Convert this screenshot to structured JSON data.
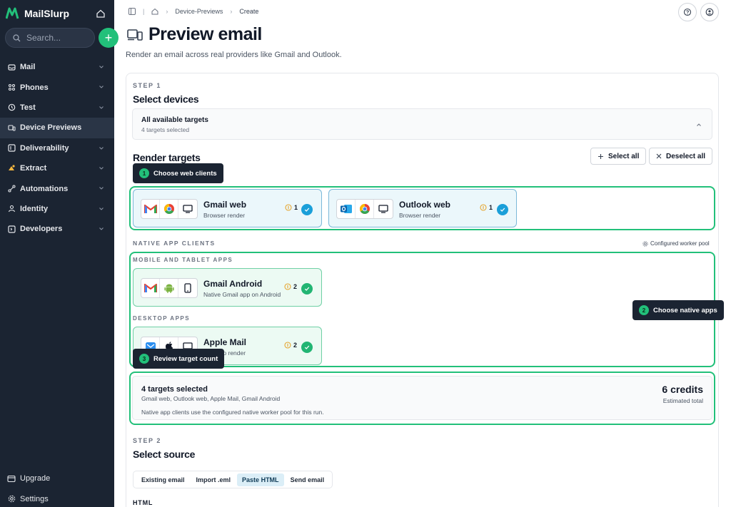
{
  "app": {
    "name": "MailSlurp"
  },
  "sidebar": {
    "search_placeholder": "Search...",
    "add_symbol": "+",
    "items": [
      {
        "label": "Mail",
        "icon": "mail-icon"
      },
      {
        "label": "Phones",
        "icon": "phones-icon"
      },
      {
        "label": "Test",
        "icon": "test-icon"
      },
      {
        "label": "Device Previews",
        "icon": "device-previews-icon"
      },
      {
        "label": "Deliverability",
        "icon": "deliverability-icon"
      },
      {
        "label": "Extract",
        "icon": "extract-icon"
      },
      {
        "label": "Automations",
        "icon": "automations-icon"
      },
      {
        "label": "Identity",
        "icon": "identity-icon"
      },
      {
        "label": "Developers",
        "icon": "developers-icon"
      }
    ],
    "active_item": "Device Previews",
    "bottom": [
      {
        "label": "Upgrade",
        "icon": "upgrade-icon"
      },
      {
        "label": "Settings",
        "icon": "gear-icon"
      }
    ]
  },
  "breadcrumb": {
    "section": "Device-Previews",
    "current": "Create"
  },
  "page": {
    "title": "Preview email",
    "subtitle": "Render an email across real providers like Gmail and Outlook."
  },
  "step1": {
    "label": "STEP 1",
    "title": "Select devices",
    "accordion_title": "All available targets",
    "accordion_sub": "4 targets selected",
    "render_targets_title": "Render targets",
    "select_all": "Select all",
    "deselect_all": "Deselect all"
  },
  "tooltips": {
    "one": {
      "num": "1",
      "text": "Choose web clients"
    },
    "two": {
      "num": "2",
      "text": "Choose native apps"
    },
    "three": {
      "num": "3",
      "text": "Review target count"
    }
  },
  "web_targets": [
    {
      "name": "Gmail web",
      "desc": "Browser render",
      "count": "1"
    },
    {
      "name": "Outlook web",
      "desc": "Browser render",
      "count": "1"
    }
  ],
  "native": {
    "label": "NATIVE APP CLIENTS",
    "pool": "Configured worker pool",
    "mobile_label": "MOBILE AND TABLET APPS",
    "desktop_label": "DESKTOP APPS",
    "mobile": {
      "name": "Gmail Android",
      "desc": "Native Gmail app on Android",
      "count": "2"
    },
    "desktop": {
      "name": "Apple Mail",
      "desc": "Mail app render",
      "count": "2"
    }
  },
  "summary": {
    "title": "4 targets selected",
    "list": "Gmail web, Outlook web, Apple Mail, Gmail Android",
    "note": "Native app clients use the configured native worker pool for this run.",
    "credits": "6 credits",
    "estimated": "Estimated total"
  },
  "step2": {
    "label": "STEP 2",
    "title": "Select source",
    "tabs": [
      "Existing email",
      "Import .eml",
      "Paste HTML",
      "Send email"
    ],
    "active_tab": "Paste HTML",
    "html_label": "HTML"
  },
  "colors": {
    "accent": "#22c07a",
    "sidebar": "#1b2432",
    "web_check": "#1a9fd9"
  }
}
